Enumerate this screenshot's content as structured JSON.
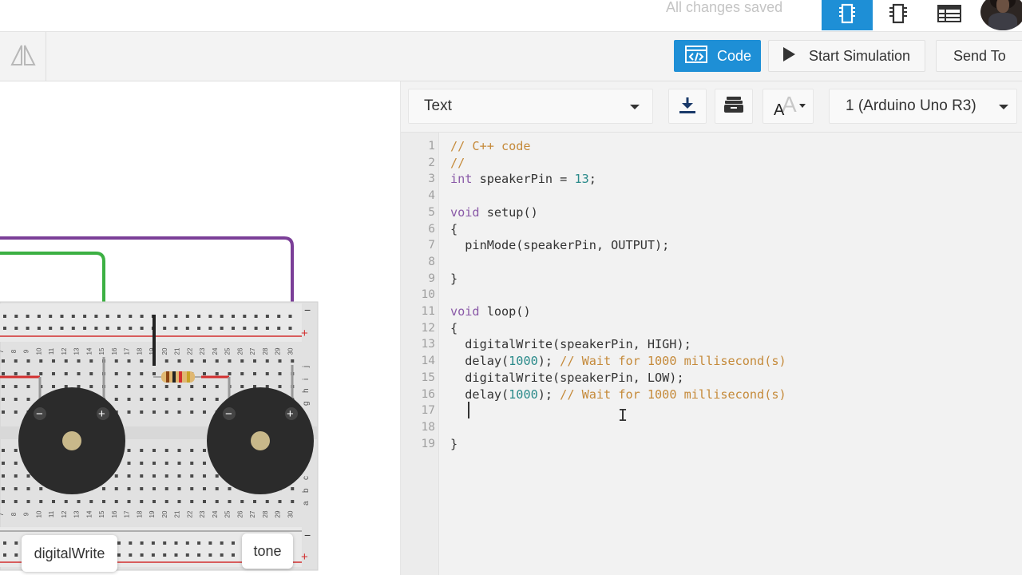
{
  "header": {
    "save_status": "All changes saved",
    "view_buttons": [
      {
        "icon": "circuit-view-icon",
        "active": true
      },
      {
        "icon": "component-list-icon",
        "active": false
      },
      {
        "icon": "table-icon",
        "active": false
      }
    ],
    "avatar_icon": "user-avatar"
  },
  "toolbar": {
    "flip_icon": "flip-icon",
    "code_label": "Code",
    "code_icon": "code-icon",
    "start_sim_label": "Start Simulation",
    "start_sim_icon": "play-icon",
    "send_to_label": "Send To"
  },
  "canvas": {
    "chips": [
      {
        "label": "digitalWrite"
      },
      {
        "label": "tone"
      }
    ],
    "breadboard_columns": [
      "7",
      "8",
      "9",
      "10",
      "11",
      "12",
      "13",
      "14",
      "15",
      "16",
      "17",
      "18",
      "19",
      "20",
      "21",
      "22",
      "23",
      "24",
      "25",
      "26",
      "27",
      "28",
      "29",
      "30"
    ],
    "breadboard_rows_top": [
      "j",
      "i",
      "h",
      "g"
    ],
    "breadboard_rows_bottom": [
      "c",
      "b",
      "a"
    ],
    "rail_signs": {
      "minus": "−",
      "plus": "+"
    },
    "buzzer_terminals": {
      "minus": "−",
      "plus": "+"
    },
    "wire_colors": {
      "green": "#3cb043",
      "purple": "#7b3f98",
      "red": "#d32f2f",
      "black": "#222222"
    }
  },
  "editor_bar": {
    "mode_select": "Text",
    "download_icon": "download-icon",
    "library_icon": "library-icon",
    "font_size_icon": "font-size-icon",
    "device_select": "1 (Arduino Uno R3)"
  },
  "code": {
    "line_numbers": [
      "1",
      "2",
      "3",
      "4",
      "5",
      "6",
      "7",
      "8",
      "9",
      "10",
      "11",
      "12",
      "13",
      "14",
      "15",
      "16",
      "17",
      "18",
      "19"
    ],
    "lines": [
      "// C++ code",
      "//",
      "int speakerPin = 13;",
      "",
      "void setup()",
      "{",
      "  pinMode(speakerPin, OUTPUT);",
      "",
      "}",
      "",
      "void loop()",
      "{",
      "  digitalWrite(speakerPin, HIGH);",
      "  delay(1000); // Wait for 1000 millisecond(s)",
      "  digitalWrite(speakerPin, LOW);",
      "  delay(1000); // Wait for 1000 millisecond(s)",
      "",
      "",
      "}"
    ]
  },
  "colors": {
    "accent": "#1e8fd6",
    "keyword": "#8a5aa8",
    "comment": "#c58a3a",
    "number": "#2a8a8a"
  }
}
